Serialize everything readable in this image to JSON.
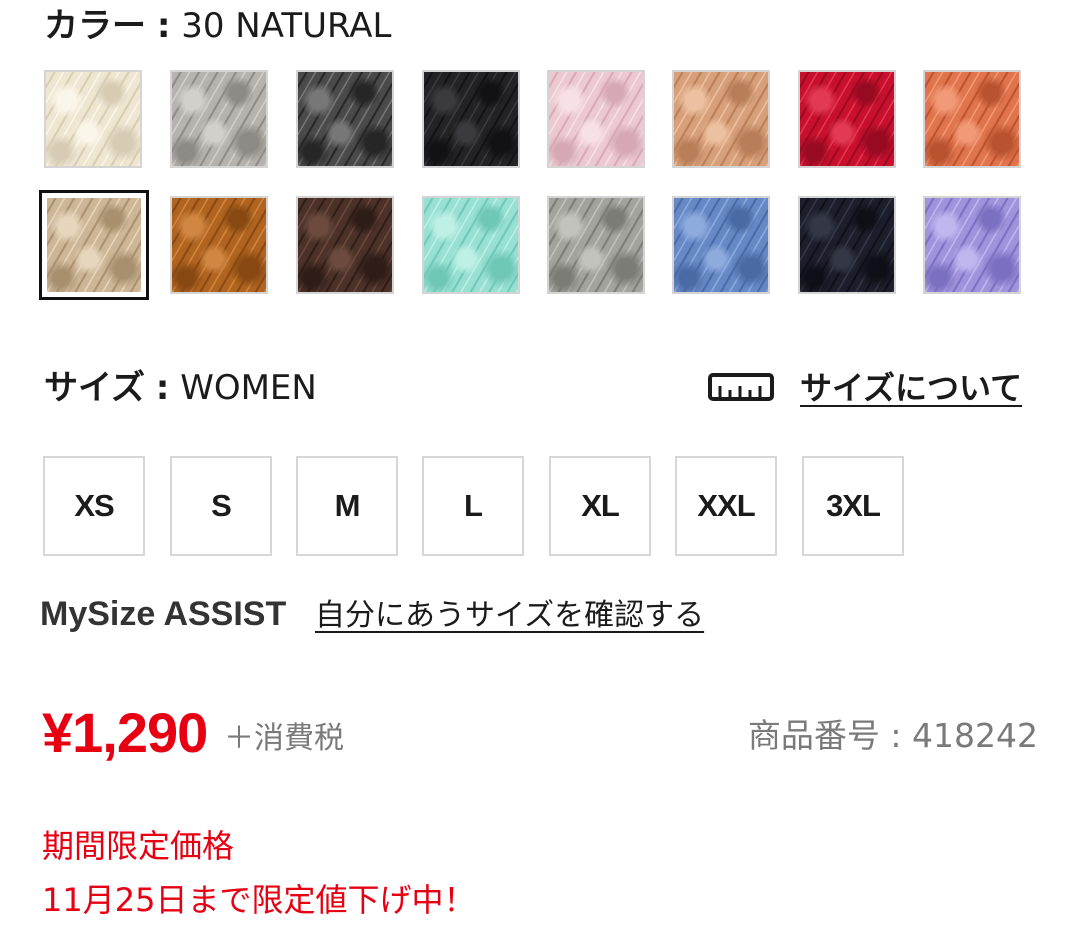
{
  "color": {
    "label": "カラー",
    "separator": ":",
    "selected": "30 NATURAL",
    "swatches": [
      {
        "base": "#efe6d2",
        "dark": "#d7ccb3",
        "light": "#fbf6ea"
      },
      {
        "base": "#b6b2ad",
        "dark": "#8e8a85",
        "light": "#d3d0cc"
      },
      {
        "base": "#4a4a4a",
        "dark": "#262626",
        "light": "#777777"
      },
      {
        "base": "#232326",
        "dark": "#121214",
        "light": "#3b3b3f"
      },
      {
        "base": "#ecc9d2",
        "dark": "#d6a8b5",
        "light": "#f7e1e7"
      },
      {
        "base": "#d8a07a",
        "dark": "#b87e58",
        "light": "#ecc1a1"
      },
      {
        "base": "#c8102e",
        "dark": "#980a20",
        "light": "#e23a54"
      },
      {
        "base": "#e0744d",
        "dark": "#b9532f",
        "light": "#f29a78"
      },
      {
        "base": "#cdb696",
        "dark": "#a8906f",
        "light": "#e6d6bd"
      },
      {
        "base": "#b0641f",
        "dark": "#874812",
        "light": "#cf8741"
      },
      {
        "base": "#4b3128",
        "dark": "#2e1c16",
        "light": "#6c4a3e"
      },
      {
        "base": "#97e0d2",
        "dark": "#6fc7b6",
        "light": "#bff0e6"
      },
      {
        "base": "#a2a39d",
        "dark": "#7b7c76",
        "light": "#c2c3bd"
      },
      {
        "base": "#6689c6",
        "dark": "#4a6aa6",
        "light": "#8eabdd"
      },
      {
        "base": "#1c1f2b",
        "dark": "#0e1018",
        "light": "#343846"
      },
      {
        "base": "#9f93dc",
        "dark": "#7b6fc0",
        "light": "#c0b7ef"
      }
    ]
  },
  "size": {
    "label": "サイズ",
    "separator": ":",
    "selected": "WOMEN",
    "guide_icon": "ruler-icon",
    "guide_link": "サイズについて",
    "options": [
      "XS",
      "S",
      "M",
      "L",
      "XL",
      "XXL",
      "3XL"
    ]
  },
  "mysize": {
    "logo_text": "MySize ASSIST",
    "link": "自分にあうサイズを確認する"
  },
  "price": {
    "amount": "¥1,290",
    "tax_note": "＋消費税",
    "product_number": "商品番号 : 418242",
    "accent_color": "#e60012"
  },
  "promo": {
    "line1": "期間限定価格",
    "line2": "11月25日まで限定値下げ中！"
  }
}
